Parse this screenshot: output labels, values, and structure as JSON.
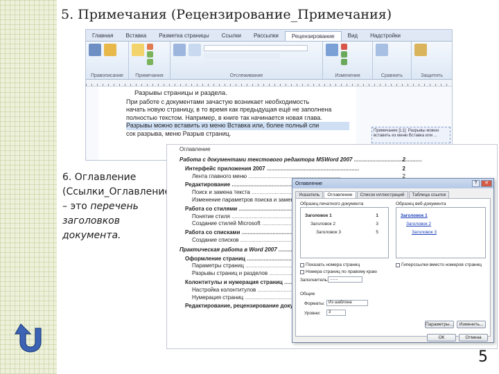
{
  "title": "5. Примечания (Рецензирование_Примечания)",
  "ribbon": {
    "tabs": [
      "Главная",
      "Вставка",
      "Разметка страницы",
      "Ссылки",
      "Рассылки",
      "Рецензирование",
      "Вид",
      "Надстройки"
    ],
    "active_tab": "Рецензирование",
    "groups": [
      "Правописание",
      "Примечания",
      "Отслеживание",
      "Изменения",
      "Сравнить",
      "Защитить"
    ]
  },
  "doc": {
    "heading": "Разрывы страницы и раздела.",
    "lines": [
      "При работе с документами зачастую возникает необходимость",
      "начать новую страницу, в то время как предыдущая ещё не заполнена",
      "полностью текстом. Например, в книге так начинается новая глава.",
      "Разрывы можно вставить из меню Вставка или, более полный спи",
      "сок разрыва, меню Разрыв страниц."
    ],
    "comment": "Примечание [L1]: Разрывы можно вставить из меню Вставка или ..."
  },
  "toc_description": {
    "heading": "6. Оглавление (Ссылки_Оглавление) – это",
    "italic_text": "перечень заголовков документа."
  },
  "toc": {
    "title": "Оглавление",
    "lines": [
      {
        "level": 1,
        "text": "Работа с документами текстового редактора MSWord 2007",
        "page": "2"
      },
      {
        "level": 2,
        "text": "Интерфейс приложения 2007",
        "page": "2"
      },
      {
        "level": 3,
        "text": "Лента главного меню",
        "page": "2"
      },
      {
        "level": 2,
        "text": "Редактирование",
        "page": ""
      },
      {
        "level": 3,
        "text": "Поиск и замена текста",
        "page": ""
      },
      {
        "level": 3,
        "text": "Изменение параметров поиска и замены",
        "page": ""
      },
      {
        "level": 2,
        "text": "Работа со стилями",
        "page": ""
      },
      {
        "level": 3,
        "text": "Понятие стиля",
        "page": ""
      },
      {
        "level": 3,
        "text": "Создание стилей Microsoft",
        "page": ""
      },
      {
        "level": 2,
        "text": "Работа со списками",
        "page": ""
      },
      {
        "level": 3,
        "text": "Создание списков",
        "page": ""
      },
      {
        "level": 1,
        "text": "Практическая работа в Word 2007",
        "page": ""
      },
      {
        "level": 2,
        "text": "Оформление страниц",
        "page": ""
      },
      {
        "level": 3,
        "text": "Параметры страниц",
        "page": ""
      },
      {
        "level": 3,
        "text": "Разрывы страниц и разделов",
        "page": ""
      },
      {
        "level": 2,
        "text": "Колонтитулы и нумерация страниц",
        "page": ""
      },
      {
        "level": 3,
        "text": "Настройка колонтитулов",
        "page": ""
      },
      {
        "level": 3,
        "text": "Нумерация страниц",
        "page": ""
      },
      {
        "level": 2,
        "text": "Редактирование, рецензирование документа",
        "page": ""
      }
    ]
  },
  "dialog": {
    "title": "Оглавление",
    "tabs": [
      "Указатель",
      "Оглавление",
      "Список иллюстраций",
      "Таблица ссылок"
    ],
    "active_tab": "Оглавление",
    "print_preview_label": "Образец печатного документа",
    "web_preview_label": "Образец веб-документа",
    "print_preview": [
      {
        "text": "Заголовок 1",
        "page": "1"
      },
      {
        "text": "Заголовок 2",
        "page": "3"
      },
      {
        "text": "Заголовок 3",
        "page": "5"
      }
    ],
    "web_preview": [
      "Заголовок 1",
      "Заголовок 2",
      "Заголовок 3"
    ],
    "chk_page_numbers": "Показать номера страниц",
    "chk_right_align": "Номера страниц по правому краю",
    "chk_hyperlinks": "Гиперссылки вместо номеров страниц",
    "leader_label": "Заполнитель:",
    "leader_value": ".......",
    "general_label": "Общие",
    "formats_label": "Форматы:",
    "formats_value": "Из шаблона",
    "levels_label": "Уровни:",
    "levels_value": "3",
    "options_button": "Параметры...",
    "modify_button": "Изменить...",
    "ok_button": "ОК",
    "cancel_button": "Отмена"
  },
  "page_number": "5",
  "colors": {
    "strip": "#eef1da",
    "back_arrow": "#3c63b4",
    "link": "#1a3fb8"
  }
}
